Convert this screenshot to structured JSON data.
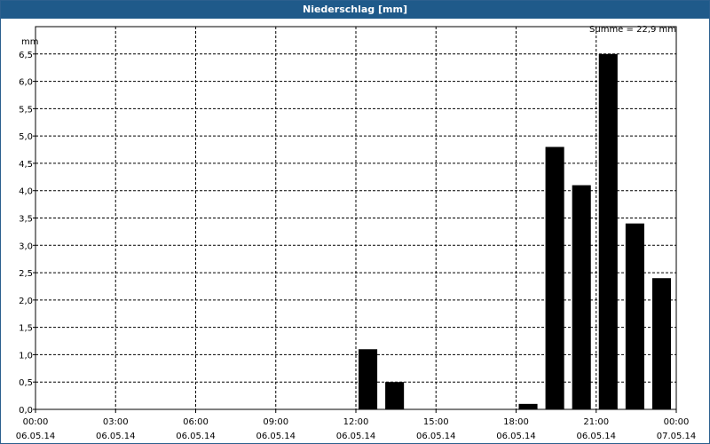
{
  "window": {
    "title": "Niederschlag [mm]"
  },
  "chart_data": {
    "type": "bar",
    "title": "Niederschlag [mm]",
    "ylabel": "mm",
    "annotation": "Summe = 22,9 mm",
    "ylim": [
      0,
      7
    ],
    "yticks": [
      "0,0",
      "0,5",
      "1,0",
      "1,5",
      "2,0",
      "2,5",
      "3,0",
      "3,5",
      "4,0",
      "4,5",
      "5,0",
      "5,5",
      "6,0",
      "6,5"
    ],
    "xticks": [
      {
        "time": "00:00",
        "date": "06.05.14"
      },
      {
        "time": "03:00",
        "date": "06.05.14"
      },
      {
        "time": "06:00",
        "date": "06.05.14"
      },
      {
        "time": "09:00",
        "date": "06.05.14"
      },
      {
        "time": "12:00",
        "date": "06.05.14"
      },
      {
        "time": "15:00",
        "date": "06.05.14"
      },
      {
        "time": "18:00",
        "date": "06.05.14"
      },
      {
        "time": "21:00",
        "date": "06.05.14"
      },
      {
        "time": "00:00",
        "date": "07.05.14"
      }
    ],
    "bars": [
      {
        "start": "12:00",
        "end": "13:00",
        "value": 1.1
      },
      {
        "start": "13:00",
        "end": "14:00",
        "value": 0.5
      },
      {
        "start": "18:00",
        "end": "19:00",
        "value": 0.1
      },
      {
        "start": "19:00",
        "end": "20:00",
        "value": 4.8
      },
      {
        "start": "20:00",
        "end": "21:00",
        "value": 4.1
      },
      {
        "start": "21:00",
        "end": "22:00",
        "value": 6.5
      },
      {
        "start": "22:00",
        "end": "23:00",
        "value": 3.4
      },
      {
        "start": "23:00",
        "end": "24:00",
        "value": 2.4
      }
    ],
    "grid": true,
    "colors": {
      "bar": "#000000",
      "title_bar": "#1f5a8a",
      "title_text": "#ffffff"
    }
  }
}
